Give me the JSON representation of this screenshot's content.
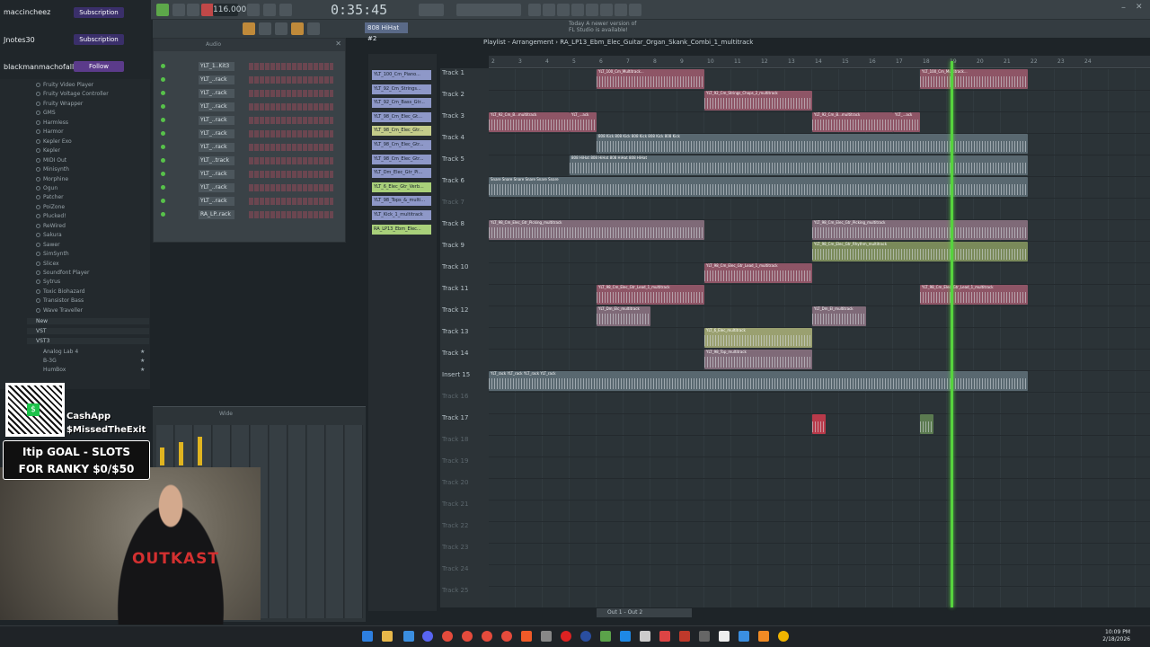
{
  "transport": {
    "time": "0:35:45",
    "tempo": "116.000",
    "pattern": "808 HiHat #2",
    "news_line1": "Today  A newer version of",
    "news_line2": "FL Studio is available!"
  },
  "chat": {
    "rows": [
      {
        "user": "maccincheez",
        "action": "Subscription"
      },
      {
        "user": "Jnotes30",
        "action": "Subscription"
      },
      {
        "user": "blackmanmachofall...",
        "action": "Follow"
      }
    ]
  },
  "browser": {
    "items": [
      "Fruity Video Player",
      "Fruity Voltage Controller",
      "Fruity Wrapper",
      "GMS",
      "Harmless",
      "Harmor",
      "Kepler Exo",
      "Kepler",
      "MIDI Out",
      "Minisynth",
      "Morphine",
      "Ogun",
      "Patcher",
      "PoiZone",
      "Plucked!",
      "ReWired",
      "Sakura",
      "Sawer",
      "SimSynth",
      "Slicex",
      "Soundfont Player",
      "Sytrus",
      "Toxic Biohazard",
      "Transistor Bass",
      "Wave Traveller"
    ],
    "folders": [
      "New",
      "VST",
      "VST3"
    ],
    "vst3_items": [
      "Analog Lab 4",
      "B-3G",
      "HumBox"
    ]
  },
  "channel_rack": {
    "title": "Audio",
    "channels": [
      "YLT_1..Kit3",
      "YLT_..rack",
      "YLT_..rack",
      "YLT_..rack",
      "YLT_..rack",
      "YLT_..rack",
      "YLT_..rack",
      "YLT_..track",
      "YLT_..rack",
      "YLT_..rack",
      "YLT_..rack",
      "RA_LP..rack"
    ]
  },
  "mixer": {
    "title": "Wide"
  },
  "pattern_list": [
    "YLT_100_Cm_Piano...",
    "YLT_92_Cm_Strings...",
    "YLT_92_Cm_Bass_Gtr...",
    "YLT_98_Cm_Elec_Gt...",
    "YLT_98_Cm_Elec_Gtr...",
    "YLT_98_Cm_Elec_Gtr...",
    "YLT_98_Cm_Elec_Gtr...",
    "YLT_Dm_Elec_Gtr_Pi...",
    "YLT_6_Elec_Gtr_Verb...",
    "YLT_98_Tops_&_multi...",
    "YLT_Kick_1_multitrack",
    "RA_LP13_Ebm_Elec..."
  ],
  "playlist": {
    "title": "Playlist - Arrangement  ›  RA_LP13_Ebm_Elec_Guitar_Organ_Skank_Combi_1_multitrack",
    "tracks": [
      "Track 1",
      "Track 2",
      "Track 3",
      "Track 4",
      "Track 5",
      "Track 6",
      "Track 7",
      "Track 8",
      "Track 9",
      "Track 10",
      "Track 11",
      "Track 12",
      "Track 13",
      "Track 14",
      "Insert 15",
      "Track 16",
      "Track 17",
      "Track 18",
      "Track 19",
      "Track 20",
      "Track 21",
      "Track 22",
      "Track 23",
      "Track 24",
      "Track 25"
    ],
    "ruler": [
      "2",
      "3",
      "4",
      "5",
      "6",
      "7",
      "8",
      "9",
      "10",
      "11",
      "12",
      "13",
      "14",
      "15",
      "16",
      "17",
      "18",
      "19",
      "20",
      "21",
      "22",
      "23",
      "24"
    ],
    "clips": [
      {
        "row": 0,
        "start": 4,
        "len": 4,
        "name": "YLT_100_Cm_Multitrack...",
        "color": "#8e5566"
      },
      {
        "row": 0,
        "start": 16,
        "len": 4,
        "name": "YLT_100_Cm_Multitrack...",
        "color": "#8e5566"
      },
      {
        "row": 1,
        "start": 8,
        "len": 4,
        "name": "YLT_92_Cm_Strings_Chops_2_multitrack",
        "color": "#8e5566"
      },
      {
        "row": 2,
        "start": 0,
        "len": 3,
        "name": "YLT_92_Cm_B...multitrack",
        "color": "#8e5566"
      },
      {
        "row": 2,
        "start": 3,
        "len": 1,
        "name": "YLT_...ack",
        "color": "#8e5566"
      },
      {
        "row": 2,
        "start": 12,
        "len": 3,
        "name": "YLT_92_Cm_B...multitrack",
        "color": "#8e5566"
      },
      {
        "row": 2,
        "start": 15,
        "len": 1,
        "name": "YLT_...ack",
        "color": "#8e5566"
      },
      {
        "row": 3,
        "start": 4,
        "len": 16,
        "name": "808 Kick  808 Kick  808 Kick  808 Kick  808 Kick",
        "color": "#596870"
      },
      {
        "row": 4,
        "start": 3,
        "len": 17,
        "name": "808 HiHat  808 HiHat  808 HiHat  808 HiHat",
        "color": "#596870"
      },
      {
        "row": 5,
        "start": 0,
        "len": 20,
        "name": "Snare  Snare  Snare  Snare  Snare  Snare",
        "color": "#596870"
      },
      {
        "row": 7,
        "start": 0,
        "len": 8,
        "name": "YLT_98_Cm_Elec_Gtr_Picking_multitrack",
        "color": "#7f6a78"
      },
      {
        "row": 7,
        "start": 12,
        "len": 8,
        "name": "YLT_98_Cm_Elec_Gtr_Picking_multitrack",
        "color": "#7f6a78"
      },
      {
        "row": 8,
        "start": 12,
        "len": 8,
        "name": "YLT_98_Cm_Elec_Gtr_Rhythm_multitrack",
        "color": "#7a8a5a"
      },
      {
        "row": 9,
        "start": 8,
        "len": 4,
        "name": "YLT_98_Cm_Elec_Gtr_Lead_1_multitrack",
        "color": "#8e5566"
      },
      {
        "row": 10,
        "start": 4,
        "len": 4,
        "name": "YLT_98_Cm_Elec_Gtr_Lead_1_multitrack",
        "color": "#8e5566"
      },
      {
        "row": 10,
        "start": 16,
        "len": 4,
        "name": "YLT_98_Cm_Elec_Gtr_Lead_1_multitrack",
        "color": "#8e5566"
      },
      {
        "row": 11,
        "start": 4,
        "len": 2,
        "name": "YLT_Dm_Elc_multitrack",
        "color": "#7f6a78"
      },
      {
        "row": 11,
        "start": 12,
        "len": 2,
        "name": "YLT_Dm_El_multitrack",
        "color": "#7f6a78"
      },
      {
        "row": 12,
        "start": 8,
        "len": 4,
        "name": "YLT_6_Elec_multitrack",
        "color": "#9aa070"
      },
      {
        "row": 13,
        "start": 8,
        "len": 4,
        "name": "YLT_98_Top_multitrack",
        "color": "#7f6a78"
      },
      {
        "row": 14,
        "start": 0,
        "len": 20,
        "name": "YLT_rack  YLT_rack  YLT_rack  YLT_rack",
        "color": "#596870"
      },
      {
        "row": 16,
        "start": 12,
        "len": 0.5,
        "name": "",
        "color": "#b83a4a"
      },
      {
        "row": 16,
        "start": 16,
        "len": 0.5,
        "name": "",
        "color": "#5b7a50"
      }
    ]
  },
  "taskbar": {
    "time": "10:09 PM",
    "date": "2/18/2026",
    "window": "Out 1 - Out 2"
  },
  "overlay": {
    "cashapp_line1": "CashApp",
    "cashapp_line2": "$MissedTheExit",
    "goal_line1": "Itip GOAL - SLOTS",
    "goal_line2": "FOR RANKY $0/$50",
    "shirt": "OUTKAST"
  }
}
